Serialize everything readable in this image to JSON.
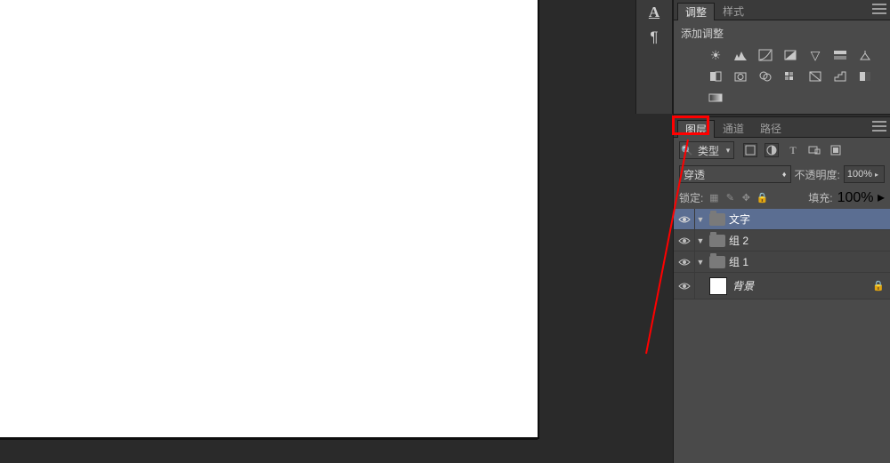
{
  "sliver": {
    "type_icon": "A",
    "para_icon": "¶"
  },
  "adjustments_panel": {
    "tabs": {
      "adjustments": "调整",
      "styles": "样式"
    },
    "title": "添加调整",
    "icon_names": [
      "brightness-icon",
      "levels-icon",
      "curves-icon",
      "exposure-icon",
      "vibrance-icon",
      "hue-sat-icon",
      "color-balance-icon",
      "bw-icon",
      "photo-filter-icon",
      "channel-mixer-icon",
      "color-lookup-icon",
      "invert-icon",
      "posterize-icon",
      "threshold-icon",
      "gradient-map-icon"
    ]
  },
  "layers_panel": {
    "tabs": {
      "layers": "图层",
      "channels": "通道",
      "paths": "路径"
    },
    "filter": {
      "label": "类型"
    },
    "blend": {
      "mode": "穿透",
      "opacity_label": "不透明度:",
      "opacity_value": "100%"
    },
    "lock": {
      "label": "锁定:",
      "fill_label": "填充:",
      "fill_value": "100%"
    },
    "layers": [
      {
        "name": "文字",
        "type": "group",
        "selected": true,
        "indent": 0
      },
      {
        "name": "组 2",
        "type": "group",
        "selected": false,
        "indent": 0
      },
      {
        "name": "组 1",
        "type": "group",
        "selected": false,
        "indent": 0
      },
      {
        "name": "背景",
        "type": "bg",
        "selected": false,
        "indent": 1,
        "locked": true
      }
    ]
  }
}
